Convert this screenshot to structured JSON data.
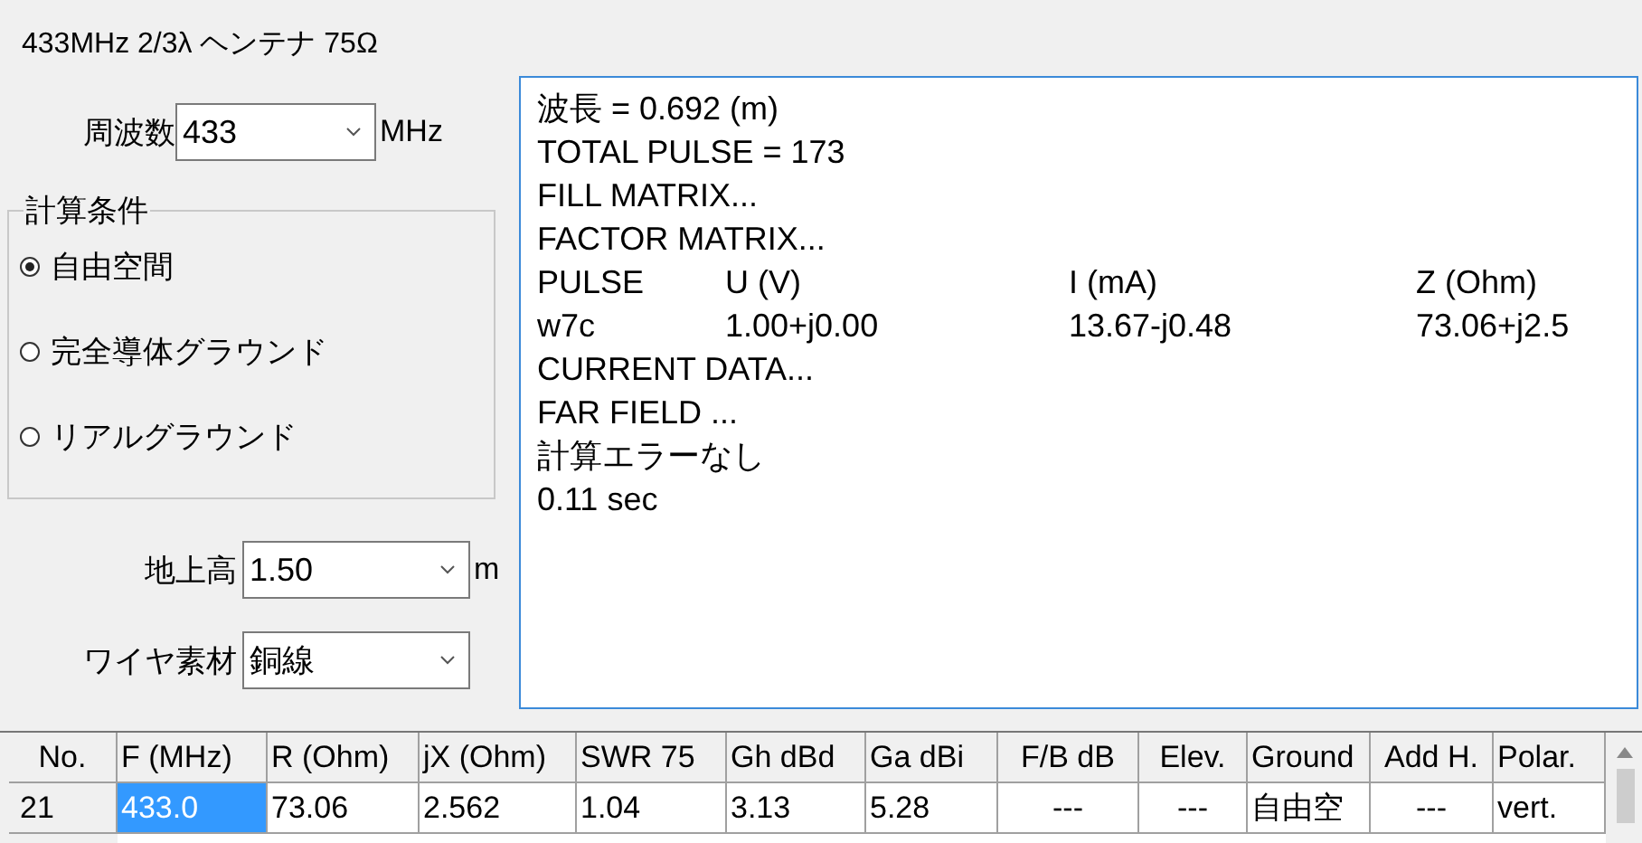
{
  "window": {
    "title": "433MHz 2/3λ  ヘンテナ 75Ω"
  },
  "frequency": {
    "label": "周波数",
    "value": "433",
    "unit": "MHz"
  },
  "conditions": {
    "legend": "計算条件",
    "options": [
      {
        "label": "自由空間",
        "selected": true
      },
      {
        "label": "完全導体グラウンド",
        "selected": false
      },
      {
        "label": "リアルグラウンド",
        "selected": false
      }
    ]
  },
  "height": {
    "label": "地上高",
    "value": "1.50",
    "unit": "m"
  },
  "wire": {
    "label": "ワイヤ素材",
    "value": "銅線"
  },
  "log": [
    {
      "kind": "text",
      "text": "波長 = 0.692 (m)"
    },
    {
      "kind": "text",
      "text": "TOTAL PULSE = 173"
    },
    {
      "kind": "text",
      "text": "FILL MATRIX..."
    },
    {
      "kind": "text",
      "text": "FACTOR MATRIX..."
    },
    {
      "kind": "columns",
      "cells": [
        "PULSE",
        "U (V)",
        "I (mA)",
        "Z (Ohm)"
      ]
    },
    {
      "kind": "columns",
      "cells": [
        "w7c",
        "1.00+j0.00",
        "13.67-j0.48",
        "73.06+j2.5"
      ]
    },
    {
      "kind": "text",
      "text": "CURRENT DATA..."
    },
    {
      "kind": "text",
      "text": "FAR FIELD ..."
    },
    {
      "kind": "text",
      "text": "計算エラーなし"
    },
    {
      "kind": "text",
      "text": "0.11 sec"
    }
  ],
  "table": {
    "columns": [
      "No.",
      "F (MHz)",
      "R (Ohm)",
      "jX (Ohm)",
      "SWR 75",
      "Gh dBd",
      "Ga dBi",
      "F/B dB",
      "Elev.",
      "Ground",
      "Add H.",
      "Polar."
    ],
    "rows": [
      {
        "cells": [
          {
            "text": "21",
            "selected": false
          },
          {
            "text": "433.0",
            "selected": true
          },
          {
            "text": "73.06",
            "selected": false
          },
          {
            "text": "2.562",
            "selected": false
          },
          {
            "text": "1.04",
            "selected": false
          },
          {
            "text": "3.13",
            "selected": false
          },
          {
            "text": "5.28",
            "selected": false
          },
          {
            "text": "---",
            "selected": false
          },
          {
            "text": "---",
            "selected": false
          },
          {
            "text": "自由空",
            "selected": false
          },
          {
            "text": "---",
            "selected": false
          },
          {
            "text": "vert.",
            "selected": false
          }
        ]
      }
    ]
  }
}
